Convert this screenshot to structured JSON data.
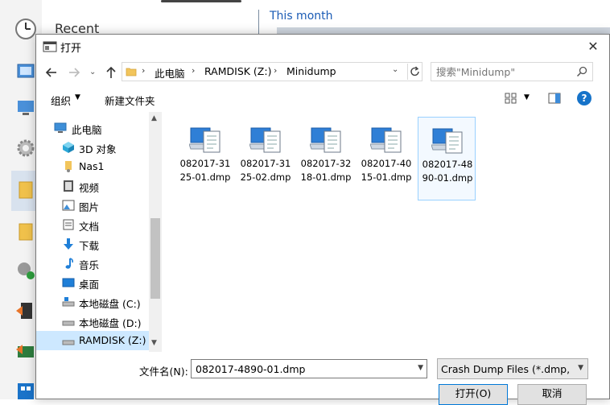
{
  "background": {
    "sidebar_recent": "Recent",
    "section_header": "This month"
  },
  "dialog": {
    "title": "打开",
    "address": {
      "crumbs": [
        "此电脑",
        "RAMDISK (Z:)",
        "Minidump"
      ]
    },
    "search": {
      "placeholder": "搜索\"Minidump\""
    },
    "toolbar": {
      "organize": "组织",
      "new_folder": "新建文件夹"
    },
    "nav": [
      {
        "label": "此电脑",
        "icon": "computer-icon"
      },
      {
        "label": "3D 对象",
        "icon": "3d-objects-icon"
      },
      {
        "label": "Nas1",
        "icon": "user-folder-icon"
      },
      {
        "label": "视频",
        "icon": "video-icon"
      },
      {
        "label": "图片",
        "icon": "pictures-icon"
      },
      {
        "label": "文档",
        "icon": "documents-icon"
      },
      {
        "label": "下载",
        "icon": "download-icon"
      },
      {
        "label": "音乐",
        "icon": "music-icon"
      },
      {
        "label": "桌面",
        "icon": "desktop-icon"
      },
      {
        "label": "本地磁盘 (C:)",
        "icon": "drive-icon"
      },
      {
        "label": "本地磁盘 (D:)",
        "icon": "drive-icon"
      },
      {
        "label": "RAMDISK (Z:)",
        "icon": "drive-icon",
        "selected": true
      }
    ],
    "files": [
      {
        "name": "082017-3125-01.dmp"
      },
      {
        "name": "082017-3125-02.dmp"
      },
      {
        "name": "082017-3218-01.dmp"
      },
      {
        "name": "082017-4015-01.dmp"
      },
      {
        "name": "082017-4890-01.dmp",
        "selected": true
      }
    ],
    "filename_label": "文件名(N):",
    "filename_value": "082017-4890-01.dmp",
    "filetype_value": "Crash Dump Files (*.dmp, *.h",
    "open_label": "打开(O)",
    "cancel_label": "取消"
  },
  "colors": {
    "accent": "#0078d7",
    "selection": "#cde8ff",
    "help": "#1673c9"
  }
}
